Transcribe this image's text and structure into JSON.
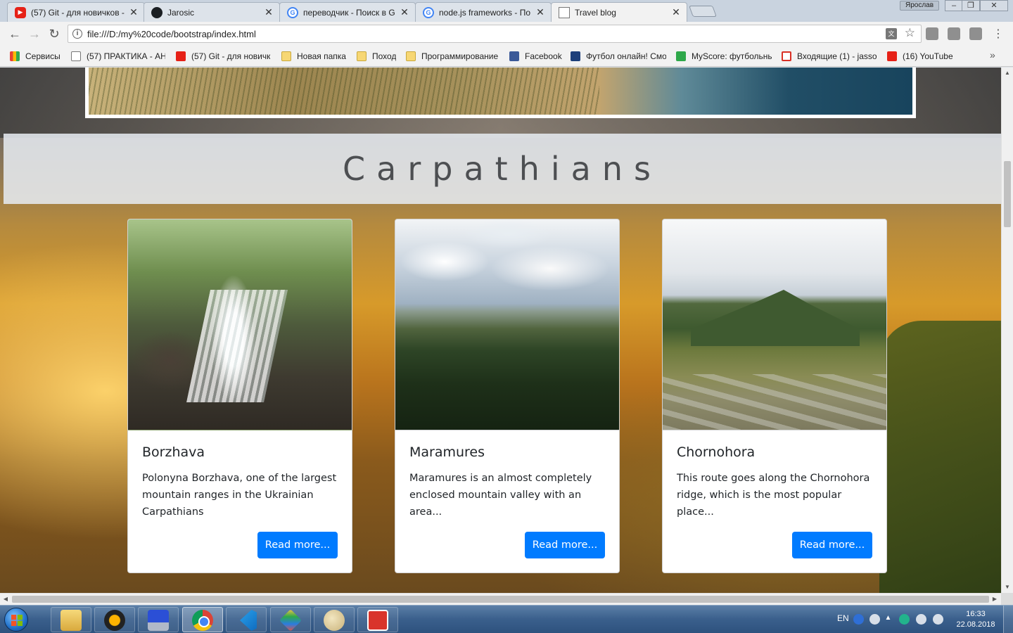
{
  "browser": {
    "tabs": [
      {
        "title": "(57) Git - для новичков -",
        "icon": "youtube-icon",
        "close": "✕"
      },
      {
        "title": "Jarosic",
        "icon": "github-icon",
        "close": "✕"
      },
      {
        "title": "переводчик - Поиск в G",
        "icon": "google-icon",
        "close": "✕"
      },
      {
        "title": "node.js frameworks - По",
        "icon": "google-icon",
        "close": "✕"
      },
      {
        "title": "Travel blog",
        "icon": "document-icon",
        "close": "✕"
      }
    ],
    "profile_name": "Ярослав",
    "url": "file:///D:/my%20code/bootstrap/index.html",
    "bookmarks": [
      {
        "label": "Сервисы",
        "icon": "apps-icon"
      },
      {
        "label": "(57) ПРАКТИКА - АН",
        "icon": "page-icon"
      },
      {
        "label": "(57) Git - для новичк",
        "icon": "youtube-icon"
      },
      {
        "label": "Новая папка",
        "icon": "folder-icon"
      },
      {
        "label": "Поход",
        "icon": "folder-icon"
      },
      {
        "label": "Программирование",
        "icon": "folder-icon"
      },
      {
        "label": "Facebook",
        "icon": "facebook-icon"
      },
      {
        "label": "Футбол онлайн! Смо",
        "icon": "onex-icon"
      },
      {
        "label": "MyScore: футбольны",
        "icon": "myscore-icon"
      },
      {
        "label": "Входящие (1) - jasso",
        "icon": "gmail-icon"
      },
      {
        "label": "(16) YouTube",
        "icon": "youtube-icon"
      }
    ],
    "bookmarks_more": "»"
  },
  "page": {
    "section_title": "Carpathians",
    "cards": [
      {
        "title": "Borzhava",
        "text": "Polonyna Borzhava, one of the largest mountain ranges in the Ukrainian Carpathians",
        "button": "Read more...",
        "image": "waterfall photo"
      },
      {
        "title": "Maramures",
        "text": "Maramures is an almost completely enclosed mountain valley with an area...",
        "button": "Read more...",
        "image": "mountain valley photo"
      },
      {
        "title": "Chornohora",
        "text": "This route goes along the Chornohora ridge, which is the most popular place...",
        "button": "Read more...",
        "image": "mountain peak photo"
      }
    ]
  },
  "taskbar": {
    "language": "EN",
    "time": "16:33",
    "date": "22.08.2018",
    "apps": [
      "explorer-icon",
      "aimp-icon",
      "save-icon",
      "chrome-icon",
      "vscode-icon",
      "git-icon",
      "paint-icon",
      "red-app-icon"
    ]
  },
  "colors": {
    "primary_button": "#007bff",
    "section_band": "#e5e9ef",
    "taskbar": "#3a5f8c"
  }
}
